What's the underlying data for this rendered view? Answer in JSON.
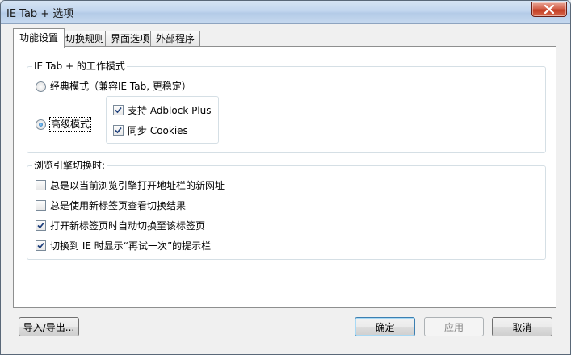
{
  "window": {
    "title": "IE Tab + 选项"
  },
  "tabs": [
    {
      "label": "功能设置",
      "active": true
    },
    {
      "label": "切换规则",
      "active": false
    },
    {
      "label": "界面选项",
      "active": false
    },
    {
      "label": "外部程序",
      "active": false
    }
  ],
  "mode_group": {
    "title": "IE Tab + 的工作模式",
    "classic": {
      "label": "经典模式（兼容IE Tab, 更稳定）",
      "selected": false
    },
    "advanced": {
      "label": "高级模式",
      "selected": true
    },
    "adblock": {
      "label": "支持 Adblock Plus",
      "checked": true
    },
    "cookies": {
      "label": "同步 Cookies",
      "checked": true
    }
  },
  "engine_group": {
    "title": "浏览引擎切换时:",
    "items": [
      {
        "label": "总是以当前浏览引擎打开地址栏的新网址",
        "checked": false
      },
      {
        "label": "总是使用新标签页查看切换结果",
        "checked": false
      },
      {
        "label": "打开新标签页时自动切换至该标签页",
        "checked": true
      },
      {
        "label": "切换到 IE 时显示“再试一次”的提示栏",
        "checked": true
      }
    ]
  },
  "buttons": {
    "import_export": "导入/导出...",
    "ok": "确定",
    "apply": "应用",
    "cancel": "取消"
  }
}
